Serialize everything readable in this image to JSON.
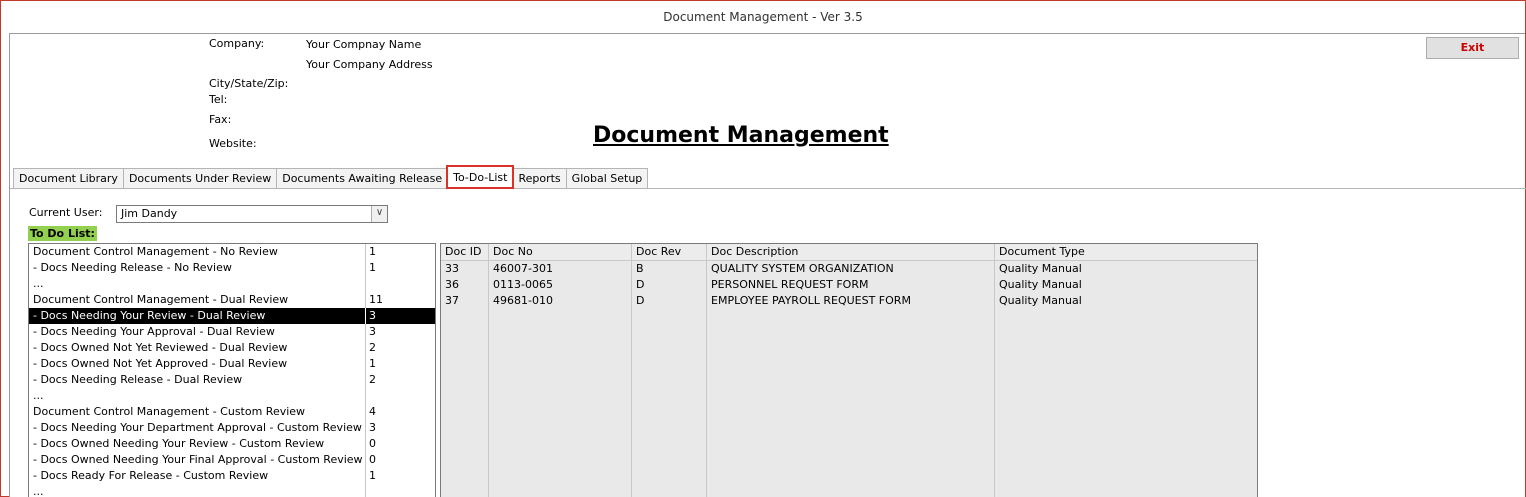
{
  "window": {
    "title": "Document Management - Ver 3.5"
  },
  "header": {
    "company_label": "Company:",
    "company_name": "Your Compnay Name",
    "company_address": "Your Company Address",
    "city_label": "City/State/Zip:",
    "tel_label": "Tel:",
    "fax_label": "Fax:",
    "website_label": "Website:",
    "exit_label": "Exit",
    "app_title": "Document Management"
  },
  "tabs": [
    {
      "label": "Document Library"
    },
    {
      "label": "Documents Under Review"
    },
    {
      "label": "Documents Awaiting Release"
    },
    {
      "label": "To-Do-List",
      "active": true
    },
    {
      "label": "Reports"
    },
    {
      "label": "Global Setup"
    }
  ],
  "user": {
    "label": "Current User:",
    "value": "Jim Dandy"
  },
  "todo": {
    "label": "To Do List:",
    "items": [
      {
        "name": "Document Control Management - No Review",
        "count": "1"
      },
      {
        "name": " - Docs Needing Release - No Review",
        "count": "1"
      },
      {
        "name": "...",
        "count": ""
      },
      {
        "name": "Document Control Management - Dual Review",
        "count": "11"
      },
      {
        "name": " - Docs Needing Your Review - Dual Review",
        "count": "3",
        "selected": true
      },
      {
        "name": " - Docs Needing Your Approval - Dual Review",
        "count": "3"
      },
      {
        "name": " - Docs Owned Not Yet Reviewed - Dual Review",
        "count": "2"
      },
      {
        "name": " - Docs Owned Not Yet Approved - Dual Review",
        "count": "1"
      },
      {
        "name": " - Docs Needing Release - Dual Review",
        "count": "2"
      },
      {
        "name": "...",
        "count": ""
      },
      {
        "name": "Document Control Management - Custom Review",
        "count": "4"
      },
      {
        "name": " - Docs Needing Your Department Approval - Custom Review",
        "count": "3"
      },
      {
        "name": " - Docs Owned Needing Your Review - Custom Review",
        "count": "0"
      },
      {
        "name": " - Docs Owned Needing Your Final Approval - Custom Review",
        "count": "0"
      },
      {
        "name": " - Docs Ready For Release - Custom Review",
        "count": "1"
      },
      {
        "name": "...",
        "count": ""
      }
    ]
  },
  "grid": {
    "columns": [
      "Doc ID",
      "Doc No",
      "Doc Rev",
      "Doc Description",
      "Document Type"
    ],
    "rows": [
      [
        "33",
        "46007-301",
        "B",
        "QUALITY SYSTEM ORGANIZATION",
        "Quality Manual"
      ],
      [
        "36",
        "0113-0065",
        "D",
        "PERSONNEL REQUEST FORM",
        "Quality Manual"
      ],
      [
        "37",
        "49681-010",
        "D",
        "EMPLOYEE PAYROLL REQUEST FORM",
        "Quality Manual"
      ]
    ]
  }
}
